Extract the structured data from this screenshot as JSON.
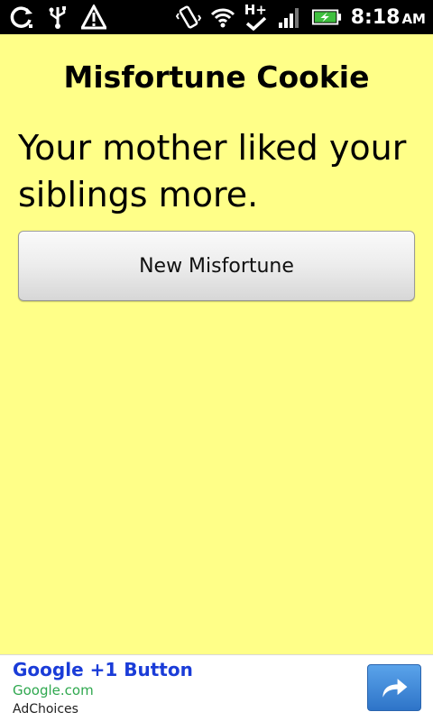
{
  "status_bar": {
    "time": "8:18",
    "ampm": "AM",
    "network_label": "H+",
    "icons": [
      "sync-icon",
      "usb-icon",
      "warning-icon",
      "vibrate-icon",
      "wifi-icon",
      "network-type-icon",
      "signal-icon",
      "battery-charging-icon"
    ]
  },
  "app": {
    "title": "Misfortune Cookie",
    "fortune": "Your mother liked your siblings more.",
    "button_label": "New Misfortune",
    "background_color": "#ffff88"
  },
  "ad": {
    "headline": "Google +1 Button",
    "url": "Google.com",
    "choices": "AdChoices",
    "action_icon": "share-arrow-icon"
  }
}
